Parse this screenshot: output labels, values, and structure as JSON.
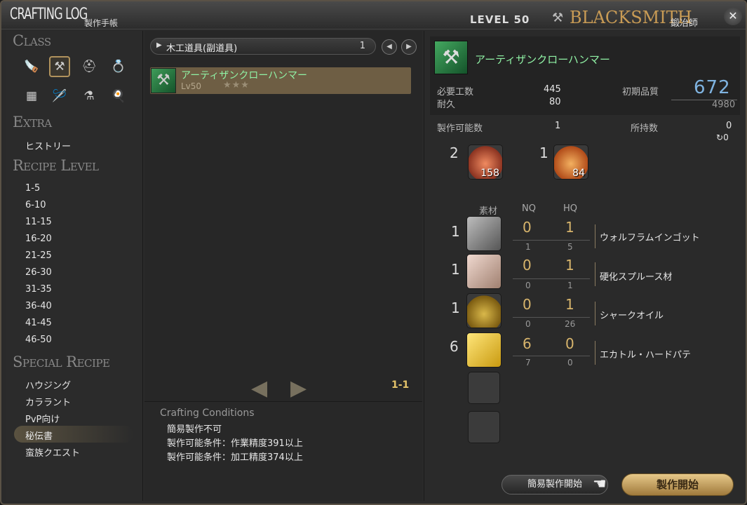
{
  "titlebar": {
    "title": "CRAFTING LOG",
    "subtitle": "製作手帳",
    "level": "LEVEL 50",
    "class_name": "BLACKSMITH",
    "class_name_jp": "鍛冶師"
  },
  "left": {
    "class_title": "Class",
    "class_icons": [
      "carpenter-icon",
      "blacksmith-icon",
      "armorer-icon",
      "goldsmith-icon",
      "leatherworker-icon",
      "weaver-icon",
      "alchemist-icon",
      "culinarian-icon"
    ],
    "extra_title": "Extra",
    "extra_items": [
      "ヒストリー"
    ],
    "recipe_level_title": "Recipe Level",
    "recipe_levels": [
      "1-5",
      "6-10",
      "11-15",
      "16-20",
      "21-25",
      "26-30",
      "31-35",
      "36-40",
      "41-45",
      "46-50"
    ],
    "special_title": "Special Recipe",
    "special_items": [
      "ハウジング",
      "カララント",
      "PvP向け",
      "秘伝書",
      "蛮族クエスト"
    ],
    "selected_special": "秘伝書"
  },
  "middle": {
    "category": "木工道具(副道具)",
    "category_count": "1",
    "recipe": {
      "name": "アーティザンクローハンマー",
      "level": "Lv50",
      "stars": "★★★"
    },
    "page_indicator": "1-1",
    "conditions_title": "Crafting Conditions",
    "conditions": [
      "簡易製作不可",
      "製作可能条件：作業精度391以上",
      "製作可能条件：加工精度374以上"
    ]
  },
  "right": {
    "item_name": "アーティザンクローハンマー",
    "difficulty_label": "必要工数",
    "difficulty": "445",
    "durability_label": "耐久",
    "durability": "80",
    "quality_label": "初期品質",
    "quality": "672",
    "quality_max": "4980",
    "craftable_label": "製作可能数",
    "craftable": "1",
    "owned_label": "所持数",
    "owned": "0",
    "owned_hq": "0",
    "crystals": [
      {
        "required": "2",
        "have": "158",
        "icon": "fire-crystal-icon"
      },
      {
        "required": "1",
        "have": "84",
        "icon": "fire-cluster-icon"
      }
    ],
    "mat_header": "素材",
    "nq_header": "NQ",
    "hq_header": "HQ",
    "materials": [
      {
        "qty": "1",
        "nq": "0",
        "hq": "1",
        "own_nq": "1",
        "own_hq": "5",
        "name": "ウォルフラムインゴット",
        "icon": "ingot-icon"
      },
      {
        "qty": "1",
        "nq": "0",
        "hq": "1",
        "own_nq": "0",
        "own_hq": "1",
        "name": "硬化スプルース材",
        "icon": "lumber-icon"
      },
      {
        "qty": "1",
        "nq": "0",
        "hq": "1",
        "own_nq": "0",
        "own_hq": "26",
        "name": "シャークオイル",
        "icon": "oil-jar-icon"
      },
      {
        "qty": "6",
        "nq": "6",
        "hq": "0",
        "own_nq": "7",
        "own_hq": "0",
        "name": "エカトル・ハードパテ",
        "icon": "paste-block-icon"
      }
    ],
    "quick_synthesis_button": "簡易製作開始",
    "synthesize_button": "製作開始"
  }
}
